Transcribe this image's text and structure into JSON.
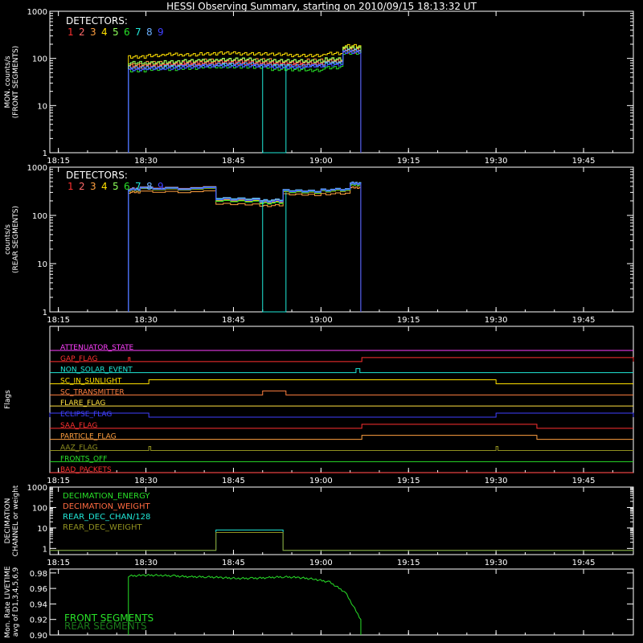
{
  "title": "HESSI Observing Summary, starting on 2010/09/15 18:13:32 UT",
  "colors": {
    "det": [
      "#ff3030",
      "#ff6a6a",
      "#ffa040",
      "#ffe000",
      "#8cff5a",
      "#28e028",
      "#20e8d8",
      "#6ab0ff",
      "#4040ff"
    ],
    "frame": "#ffffff"
  },
  "x_ticks": [
    "18:15",
    "18:30",
    "18:45",
    "19:00",
    "19:15",
    "19:30",
    "19:45"
  ],
  "chart_data": [
    {
      "type": "line",
      "id": "front",
      "ylabel": [
        "MON. counts/s",
        "(FRONT SEGMENTS)"
      ],
      "yscale": "log",
      "ylim": [
        1,
        1000
      ],
      "y_ticks": [
        "1",
        "10",
        "100",
        "1000"
      ],
      "xlim": [
        "18:13:32",
        "19:53:32"
      ],
      "legend_title": "DETECTORS:",
      "legend": [
        "1",
        "2",
        "3",
        "4",
        "5",
        "6",
        "7",
        "8",
        "9"
      ],
      "data_start": "18:27:00",
      "data_end": "19:06:50",
      "series": [
        {
          "name": "1",
          "values": [
            65,
            68,
            72,
            75,
            78,
            80,
            80,
            78,
            76,
            75,
            78,
            85,
            140
          ]
        },
        {
          "name": "2",
          "values": [
            70,
            72,
            75,
            78,
            82,
            85,
            85,
            82,
            80,
            78,
            80,
            88,
            150
          ]
        },
        {
          "name": "3",
          "values": [
            75,
            80,
            85,
            88,
            90,
            95,
            95,
            92,
            90,
            88,
            90,
            95,
            160
          ]
        },
        {
          "name": "4",
          "values": [
            110,
            115,
            120,
            122,
            125,
            128,
            128,
            125,
            120,
            118,
            115,
            125,
            190
          ]
        },
        {
          "name": "5",
          "values": [
            80,
            82,
            85,
            88,
            92,
            95,
            95,
            92,
            90,
            88,
            90,
            98,
            165
          ]
        },
        {
          "name": "6",
          "values": [
            55,
            58,
            60,
            62,
            65,
            68,
            66,
            64,
            60,
            58,
            55,
            65,
            130
          ]
        },
        {
          "name": "7",
          "values": [
            60,
            62,
            65,
            68,
            70,
            72,
            72,
            70,
            68,
            66,
            70,
            78,
            140
          ]
        },
        {
          "name": "8",
          "values": [
            62,
            65,
            68,
            70,
            72,
            75,
            75,
            72,
            70,
            68,
            72,
            80,
            145
          ]
        },
        {
          "name": "9",
          "values": [
            58,
            60,
            63,
            66,
            68,
            70,
            70,
            68,
            66,
            65,
            68,
            75,
            135
          ]
        }
      ],
      "dropout": {
        "series": "7",
        "start": "18:50:00",
        "end": "18:54:00",
        "value": 1
      }
    },
    {
      "type": "line",
      "id": "rear",
      "ylabel": [
        "counts/s",
        "(REAR SEGMENTS)"
      ],
      "yscale": "log",
      "ylim": [
        1,
        1000
      ],
      "y_ticks": [
        "1",
        "10",
        "100",
        "1000"
      ],
      "xlim": [
        "18:13:32",
        "19:53:32"
      ],
      "legend_title": "DETECTORS:",
      "legend": [
        "1",
        "2",
        "3",
        "4",
        "5",
        "6",
        "7",
        "8",
        "9"
      ],
      "data_start": "18:27:00",
      "data_end": "19:06:50",
      "segments_x": [
        "18:27:00",
        "18:29:00",
        "18:42:00",
        "18:49:30",
        "18:53:30",
        "19:00:00",
        "19:05:00",
        "19:06:50"
      ],
      "series": [
        {
          "name": "1",
          "values": [
            360,
            380,
            215,
            200,
            320,
            340,
            460
          ]
        },
        {
          "name": "2",
          "values": [
            340,
            360,
            205,
            190,
            310,
            330,
            440
          ]
        },
        {
          "name": "3",
          "values": [
            300,
            310,
            170,
            160,
            270,
            280,
            380
          ]
        },
        {
          "name": "4",
          "values": [
            330,
            350,
            200,
            185,
            300,
            320,
            430
          ]
        },
        {
          "name": "5",
          "values": [
            345,
            365,
            210,
            195,
            315,
            335,
            450
          ]
        },
        {
          "name": "6",
          "values": [
            335,
            355,
            195,
            180,
            305,
            325,
            435
          ]
        },
        {
          "name": "7",
          "values": [
            350,
            370,
            220,
            205,
            325,
            345,
            470
          ]
        },
        {
          "name": "8",
          "values": [
            355,
            375,
            225,
            210,
            330,
            350,
            480
          ]
        },
        {
          "name": "9",
          "values": [
            340,
            360,
            210,
            195,
            315,
            335,
            455
          ]
        }
      ],
      "dropout": {
        "series": "7",
        "start": "18:50:00",
        "end": "18:54:00",
        "value": 1
      }
    },
    {
      "type": "line",
      "id": "flags",
      "ylabel": [
        "Flags"
      ],
      "xlim": [
        "18:13:32",
        "19:53:32"
      ],
      "flags": [
        {
          "name": "ATTENUATOR_STATE",
          "color": "#ff40ff",
          "events": []
        },
        {
          "name": "SAA_FLAG",
          "color": "#ff3030",
          "events": [
            [
              "18:27:00",
              "18:27:00"
            ],
            [
              "19:07:00",
              "19:53:32"
            ]
          ],
          "label": "GAP_FLAG"
        },
        {
          "name": "NON_SOLAR_EVENT",
          "color": "#20e8d8",
          "events": [
            [
              "19:06:00",
              "19:06:40"
            ]
          ]
        },
        {
          "name": "SC_IN_SUNLIGHT",
          "color": "#ffe000",
          "events": [
            [
              "18:30:30",
              "19:30:00"
            ]
          ]
        },
        {
          "name": "SC_TRANSMITTER",
          "color": "#ff8040",
          "events": [
            [
              "18:50:00",
              "18:54:00"
            ]
          ]
        },
        {
          "name": "FLARE_FLAG",
          "color": "#ffe040",
          "events": []
        },
        {
          "name": "ECLIPSE_FLAG",
          "color": "#4040ff",
          "events": [
            [
              "18:13:32",
              "18:30:30"
            ],
            [
              "19:30:00",
              "19:53:32"
            ]
          ]
        },
        {
          "name": "SAA_FLAG",
          "color": "#ff3030",
          "events": [
            [
              "19:07:00",
              "19:37:00"
            ]
          ]
        },
        {
          "name": "PARTICLE_FLAG",
          "color": "#ffa040",
          "events": [
            [
              "19:07:00",
              "19:37:00"
            ]
          ]
        },
        {
          "name": "AAZ_FLAG",
          "color": "#909020",
          "events": [
            [
              "18:30:30",
              "18:30:50"
            ],
            [
              "19:30:00",
              "19:30:20"
            ]
          ]
        },
        {
          "name": "FRONTS_OFF",
          "color": "#28e028",
          "events": []
        },
        {
          "name": "BAD_PACKETS",
          "color": "#ff3030",
          "events": []
        }
      ]
    },
    {
      "type": "line",
      "id": "decimation",
      "ylabel": [
        "DECIMATION",
        "CHANNEL or weight"
      ],
      "yscale": "log",
      "ylim": [
        0.5,
        1000
      ],
      "y_ticks": [
        "1",
        "10",
        "100",
        "1000"
      ],
      "xlim": [
        "18:13:32",
        "19:53:32"
      ],
      "legend": [
        {
          "name": "DECIMATION_ENERGY",
          "color": "#28e028"
        },
        {
          "name": "DECIMATION_WEIGHT",
          "color": "#ff6a40"
        },
        {
          "name": "REAR_DEC_CHAN/128",
          "color": "#20e8d8"
        },
        {
          "name": "REAR_DEC_WEIGHT",
          "color": "#909020"
        }
      ],
      "boxes": [
        {
          "start": "18:42:00",
          "end": "18:53:30",
          "value": 8,
          "color": "#20e8d8"
        },
        {
          "start": "18:42:00",
          "end": "18:53:30",
          "value": 6,
          "color": "#909020"
        }
      ]
    },
    {
      "type": "line",
      "id": "livetime",
      "ylabel": [
        "Mon. Rate LIVETIME",
        "avg of D1,3,4,5,6,9"
      ],
      "ylim": [
        0.9,
        0.985
      ],
      "y_ticks": [
        "0.90",
        "0.92",
        "0.94",
        "0.96",
        "0.98"
      ],
      "xlim": [
        "18:13:32",
        "19:53:32"
      ],
      "legend": [
        {
          "name": "FRONT SEGMENTS",
          "color": "#28e028"
        },
        {
          "name": "REAR SEGMENTS",
          "color": "#1a7a1a"
        }
      ],
      "data_start": "18:27:00",
      "data_end": "19:06:50",
      "values": [
        0.976,
        0.977,
        0.977,
        0.976,
        0.975,
        0.975,
        0.974,
        0.973,
        0.973,
        0.974,
        0.975,
        0.974,
        0.972,
        0.968,
        0.955,
        0.92
      ]
    }
  ]
}
